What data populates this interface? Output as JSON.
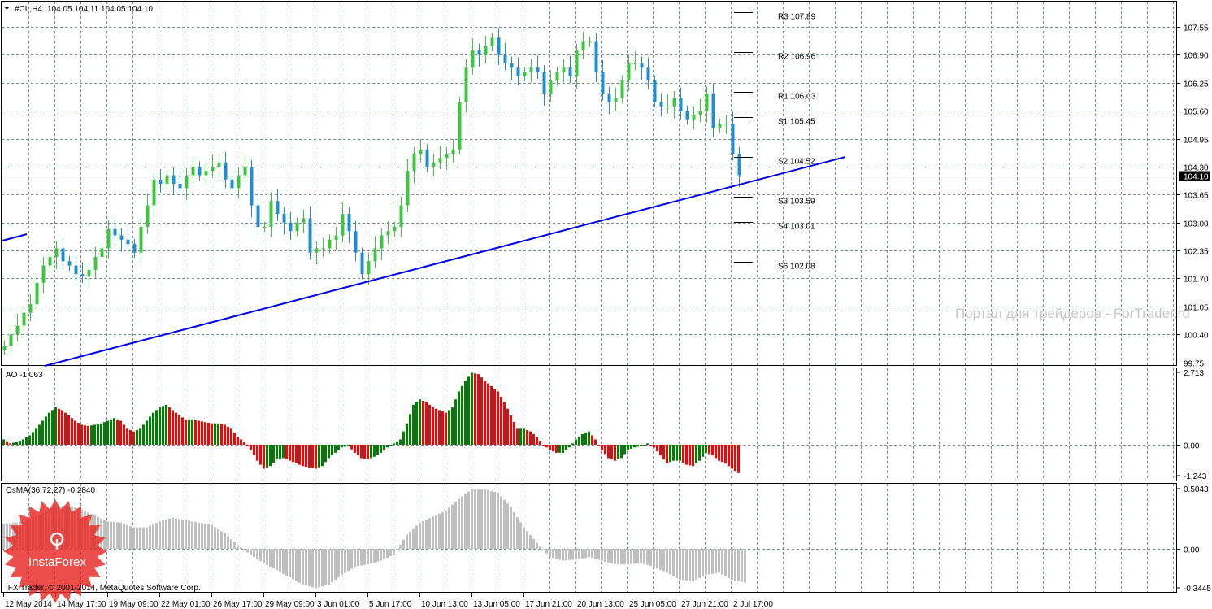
{
  "header": {
    "symbol": "#CL,H4",
    "ohlc": "104.05 104.11 104.05 104.10"
  },
  "watermark": "Портал для трейдеров - ForTrader.ru",
  "copyright": "IFX Trader, © 2001-2014, MetaQuotes Software Corp.",
  "logo": {
    "text": "InstaForex"
  },
  "colors": {
    "bull": "#3cc83c",
    "bear": "#1e8fd0",
    "trend": "#0000e6",
    "ao_up": "#008000",
    "ao_down": "#ff0000",
    "osma": "#c0c0c0"
  },
  "chart_data": [
    {
      "type": "candlestick",
      "title": "#CL,H4",
      "current_price": "104.10",
      "ylim": [
        99.75,
        107.89
      ],
      "y_ticks": [
        "107.55",
        "106.90",
        "106.25",
        "105.60",
        "104.95",
        "104.30",
        "103.65",
        "103.00",
        "102.35",
        "101.70",
        "101.05",
        "100.40",
        "99.75"
      ],
      "x_ticks": [
        "12 May 2014",
        "14 May 17:00",
        "19 May 09:00",
        "22 May 01:00",
        "26 May 17:00",
        "29 May 09:00",
        "3 Jun 01:00",
        "5 Jun 17:00",
        "10 Jun 13:00",
        "13 Jun 05:00",
        "17 Jun 21:00",
        "20 Jun 13:00",
        "25 Jun 05:00",
        "27 Jun 21:00",
        "2 Jul 17:00"
      ],
      "closes": [
        100.14,
        100.4,
        100.6,
        100.9,
        101.1,
        101.6,
        102.0,
        102.2,
        102.4,
        102.1,
        102.0,
        101.8,
        101.75,
        101.9,
        102.2,
        102.4,
        102.85,
        102.7,
        102.6,
        102.5,
        102.3,
        102.9,
        103.4,
        104.0,
        103.9,
        104.1,
        103.9,
        103.8,
        104.1,
        104.3,
        104.1,
        104.2,
        104.3,
        104.4,
        104.0,
        103.8,
        104.1,
        104.3,
        103.4,
        102.9,
        102.9,
        103.5,
        103.2,
        103.0,
        102.8,
        103.0,
        103.1,
        102.3,
        102.4,
        102.4,
        102.6,
        102.7,
        103.2,
        102.8,
        102.3,
        101.8,
        102.1,
        102.4,
        102.7,
        102.8,
        102.9,
        103.4,
        104.2,
        104.6,
        104.7,
        104.3,
        104.4,
        104.5,
        104.6,
        104.7,
        105.8,
        106.6,
        107.0,
        106.9,
        107.1,
        107.3,
        106.9,
        106.7,
        106.6,
        106.4,
        106.5,
        106.6,
        106.5,
        106.0,
        106.3,
        106.5,
        106.6,
        106.4,
        107.0,
        107.2,
        107.2,
        106.5,
        106.0,
        105.8,
        105.9,
        106.3,
        106.7,
        106.7,
        106.6,
        106.3,
        105.8,
        105.7,
        105.7,
        105.9,
        105.6,
        105.4,
        105.5,
        105.6,
        106.0,
        105.2,
        105.3,
        105.3,
        104.6,
        104.1
      ],
      "pivots": [
        {
          "label": "R3 107.89",
          "value": 107.89
        },
        {
          "label": "R2 106.96",
          "value": 106.96
        },
        {
          "label": "R1 106.03",
          "value": 106.03
        },
        {
          "label": "S1 105.45",
          "value": 105.45
        },
        {
          "label": "S2 104.52",
          "value": 104.52
        },
        {
          "label": "S3 103.59",
          "value": 103.59
        },
        {
          "label": "S4 103.01",
          "value": 103.01
        },
        {
          "label": "S6 102.08",
          "value": 102.08
        }
      ]
    },
    {
      "type": "histogram",
      "title": "AO -1.063",
      "ylim": [
        -1.243,
        2.713
      ],
      "y_ticks": [
        "2.713",
        "0.00",
        "-1.243"
      ],
      "values": [
        0.2,
        0.05,
        0.1,
        0.2,
        0.35,
        0.6,
        0.9,
        1.2,
        1.4,
        1.3,
        1.1,
        0.9,
        0.75,
        0.7,
        0.75,
        0.8,
        0.9,
        1.0,
        0.9,
        0.6,
        0.5,
        0.6,
        0.9,
        1.2,
        1.4,
        1.5,
        1.3,
        1.1,
        0.95,
        0.95,
        0.9,
        0.85,
        0.8,
        0.8,
        0.75,
        0.6,
        0.3,
        0.1,
        -0.2,
        -0.6,
        -0.9,
        -0.8,
        -0.55,
        -0.5,
        -0.6,
        -0.7,
        -0.8,
        -0.85,
        -0.9,
        -0.8,
        -0.5,
        -0.3,
        -0.1,
        -0.05,
        -0.3,
        -0.5,
        -0.55,
        -0.45,
        -0.3,
        -0.1,
        0.05,
        0.2,
        0.8,
        1.5,
        1.7,
        1.6,
        1.4,
        1.3,
        1.2,
        1.4,
        2.0,
        2.4,
        2.7,
        2.65,
        2.4,
        2.2,
        2.0,
        1.6,
        1.1,
        0.6,
        0.6,
        0.5,
        0.3,
        0.0,
        -0.2,
        -0.3,
        -0.3,
        -0.1,
        0.2,
        0.4,
        0.5,
        0.2,
        -0.2,
        -0.5,
        -0.6,
        -0.5,
        -0.2,
        -0.1,
        -0.05,
        0.05,
        -0.1,
        -0.4,
        -0.7,
        -0.6,
        -0.6,
        -0.75,
        -0.8,
        -0.6,
        -0.3,
        -0.4,
        -0.6,
        -0.7,
        -0.9,
        -1.063
      ]
    },
    {
      "type": "histogram",
      "title": "OsMA(36,72,27) -0.2840",
      "ylim": [
        -0.3445,
        0.5043
      ],
      "y_ticks": [
        "0.5043",
        "0.00",
        "-0.3445"
      ],
      "values": [
        0.21,
        0.22,
        0.25,
        0.3,
        0.36,
        0.36,
        0.33,
        0.28,
        0.23,
        0.22,
        0.18,
        0.18,
        0.23,
        0.26,
        0.24,
        0.22,
        0.2,
        0.13,
        0.03,
        -0.05,
        -0.12,
        -0.18,
        -0.24,
        -0.3,
        -0.33,
        -0.3,
        -0.22,
        -0.15,
        -0.13,
        -0.1,
        -0.05,
        0.12,
        0.22,
        0.27,
        0.32,
        0.42,
        0.5,
        0.5,
        0.47,
        0.35,
        0.18,
        0.05,
        -0.07,
        -0.1,
        -0.09,
        -0.07,
        -0.1,
        -0.13,
        -0.13,
        -0.12,
        -0.15,
        -0.2,
        -0.26,
        -0.27,
        -0.22,
        -0.2,
        -0.26,
        -0.284
      ]
    }
  ]
}
